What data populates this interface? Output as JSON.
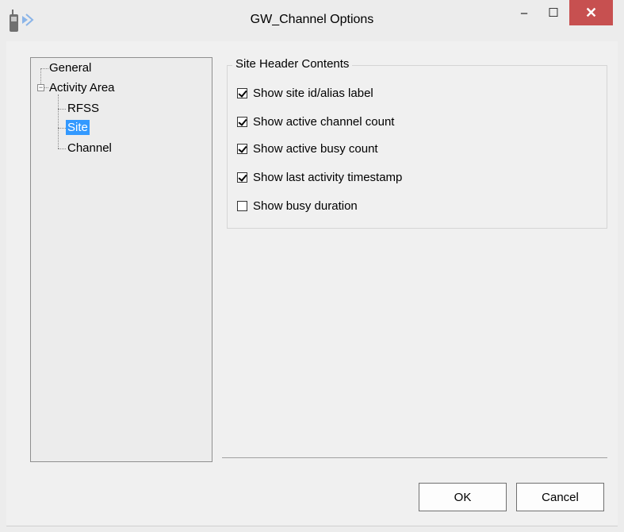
{
  "window": {
    "title": "GW_Channel Options",
    "minimize_glyph": "–",
    "maximize_glyph": "☐",
    "close_glyph": "✕"
  },
  "tree": {
    "items": [
      {
        "label": "General",
        "level": 0
      },
      {
        "label": "Activity Area",
        "level": 0,
        "expanded": true
      },
      {
        "label": "RFSS",
        "level": 1
      },
      {
        "label": "Site",
        "level": 1,
        "selected": true
      },
      {
        "label": "Channel",
        "level": 1
      }
    ],
    "expander_glyph": "−"
  },
  "site_header": {
    "title": "Site Header Contents",
    "options": [
      {
        "label": "Show site id/alias label",
        "checked": true
      },
      {
        "label": "Show active channel count",
        "checked": true
      },
      {
        "label": "Show active busy count",
        "checked": true
      },
      {
        "label": "Show last activity timestamp",
        "checked": true
      },
      {
        "label": "Show busy duration",
        "checked": false
      }
    ]
  },
  "buttons": {
    "ok": "OK",
    "cancel": "Cancel"
  },
  "icons": {
    "app": "radio-signal-icon"
  }
}
